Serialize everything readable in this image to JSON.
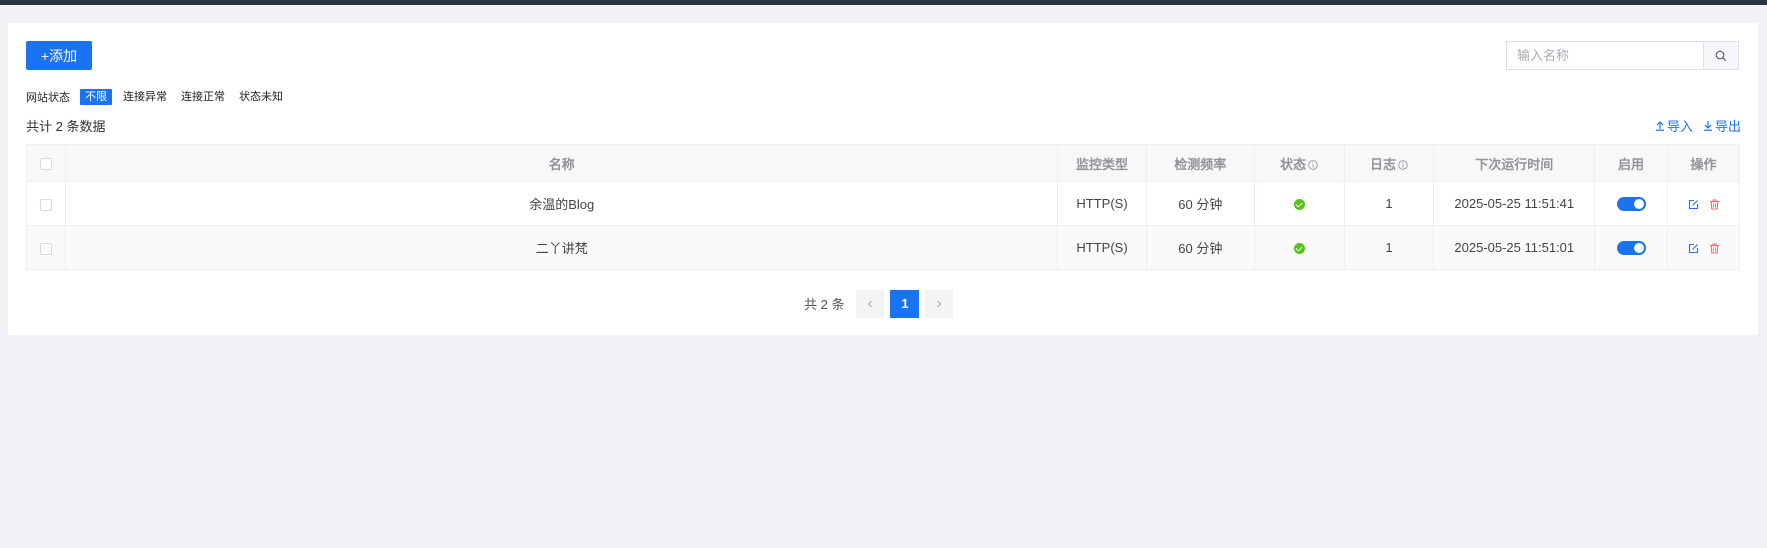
{
  "toolbar": {
    "add_label": "+添加",
    "search_placeholder": "输入名称",
    "import_label": "导入",
    "export_label": "导出"
  },
  "filters": {
    "label": "网站状态",
    "options": [
      "不限",
      "连接异常",
      "连接正常",
      "状态未知"
    ],
    "active": "不限"
  },
  "summary": {
    "total_text": "共计 2 条数据"
  },
  "table": {
    "headers": {
      "name": "名称",
      "type": "监控类型",
      "freq": "检测频率",
      "status": "状态",
      "log": "日志",
      "next": "下次运行时间",
      "enabled": "启用",
      "actions": "操作"
    },
    "rows": [
      {
        "name": "余温的Blog",
        "type": "HTTP(S)",
        "freq": "60 分钟",
        "status": "ok",
        "log": "1",
        "next": "2025-05-25 11:51:41",
        "enabled": true
      },
      {
        "name": "二丫讲梵",
        "type": "HTTP(S)",
        "freq": "60 分钟",
        "status": "ok",
        "log": "1",
        "next": "2025-05-25 11:51:01",
        "enabled": true
      }
    ]
  },
  "pagination": {
    "total_text": "共 2 条",
    "current_page": "1"
  },
  "colors": {
    "primary": "#1a73f0",
    "success": "#52c41a",
    "danger": "#f56c6c"
  }
}
